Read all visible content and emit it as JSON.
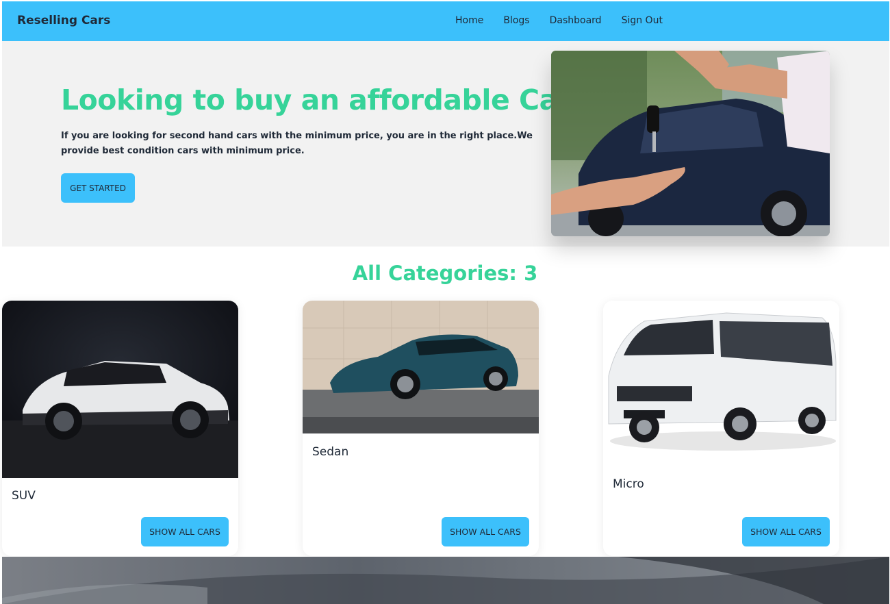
{
  "navbar": {
    "brand": "Reselling Cars",
    "links": [
      "Home",
      "Blogs",
      "Dashboard",
      "Sign Out"
    ],
    "bg_color": "#3cc0fb"
  },
  "hero": {
    "title": "Looking to buy an affordable Car?",
    "text": "If you are looking for second hand cars with the minimum price, you are in the right place.We provide best condition cars with minimum price.",
    "button": "GET STARTED",
    "title_color": "#36d399",
    "image": "car-key-handover-photo"
  },
  "categories": {
    "title": "All Categories: 3",
    "items": [
      {
        "name": "SUV",
        "button": "SHOW ALL CARS",
        "image": "white-suv-photo"
      },
      {
        "name": "Sedan",
        "button": "SHOW ALL CARS",
        "image": "blue-sedan-photo"
      },
      {
        "name": "Micro",
        "button": "SHOW ALL CARS",
        "image": "white-minivan-photo"
      }
    ]
  },
  "footer_banner": {
    "image": "car-interior-photo"
  }
}
